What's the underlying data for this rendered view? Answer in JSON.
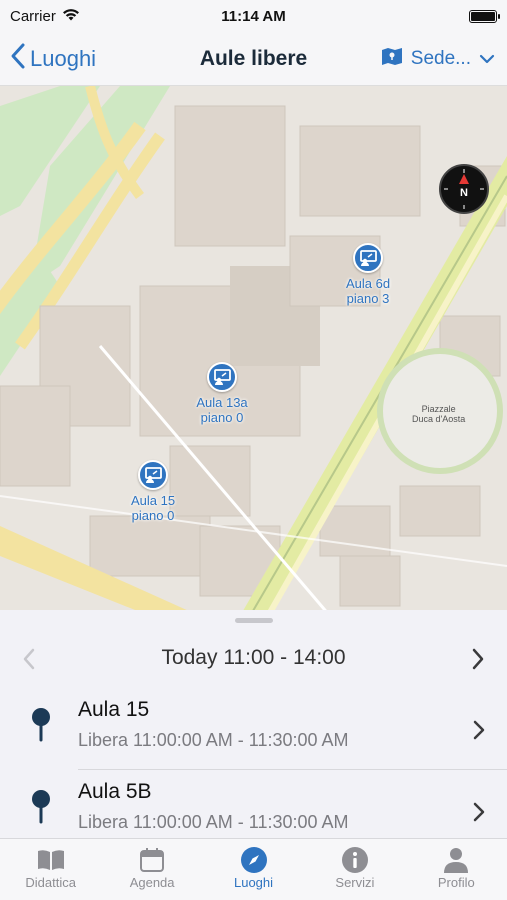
{
  "status": {
    "carrier": "Carrier",
    "time": "11:14 AM"
  },
  "nav": {
    "back_label": "Luoghi",
    "title": "Aule libere",
    "right_label": "Sede..."
  },
  "map": {
    "markers": [
      {
        "name": "Aula 6d",
        "floor": "piano 3"
      },
      {
        "name": "Aula 13a",
        "floor": "piano 0"
      },
      {
        "name": "Aula 15",
        "floor": "piano 0"
      }
    ],
    "place_label_line1": "Piazzale",
    "place_label_line2": "Duca d'Aosta",
    "compass_letter": "N"
  },
  "sheet": {
    "date_label": "Today 11:00 - 14:00",
    "rooms": [
      {
        "name": "Aula 15",
        "status": "Libera 11:00:00 AM - 11:30:00 AM"
      },
      {
        "name": "Aula 5B",
        "status": "Libera 11:00:00 AM - 11:30:00 AM"
      }
    ]
  },
  "tabs": [
    {
      "label": "Didattica",
      "icon": "book-icon"
    },
    {
      "label": "Agenda",
      "icon": "calendar-icon"
    },
    {
      "label": "Luoghi",
      "icon": "compass-icon"
    },
    {
      "label": "Servizi",
      "icon": "info-icon"
    },
    {
      "label": "Profilo",
      "icon": "person-icon"
    }
  ],
  "colors": {
    "accent": "#2f74c0",
    "inactive": "#8e8e93"
  }
}
